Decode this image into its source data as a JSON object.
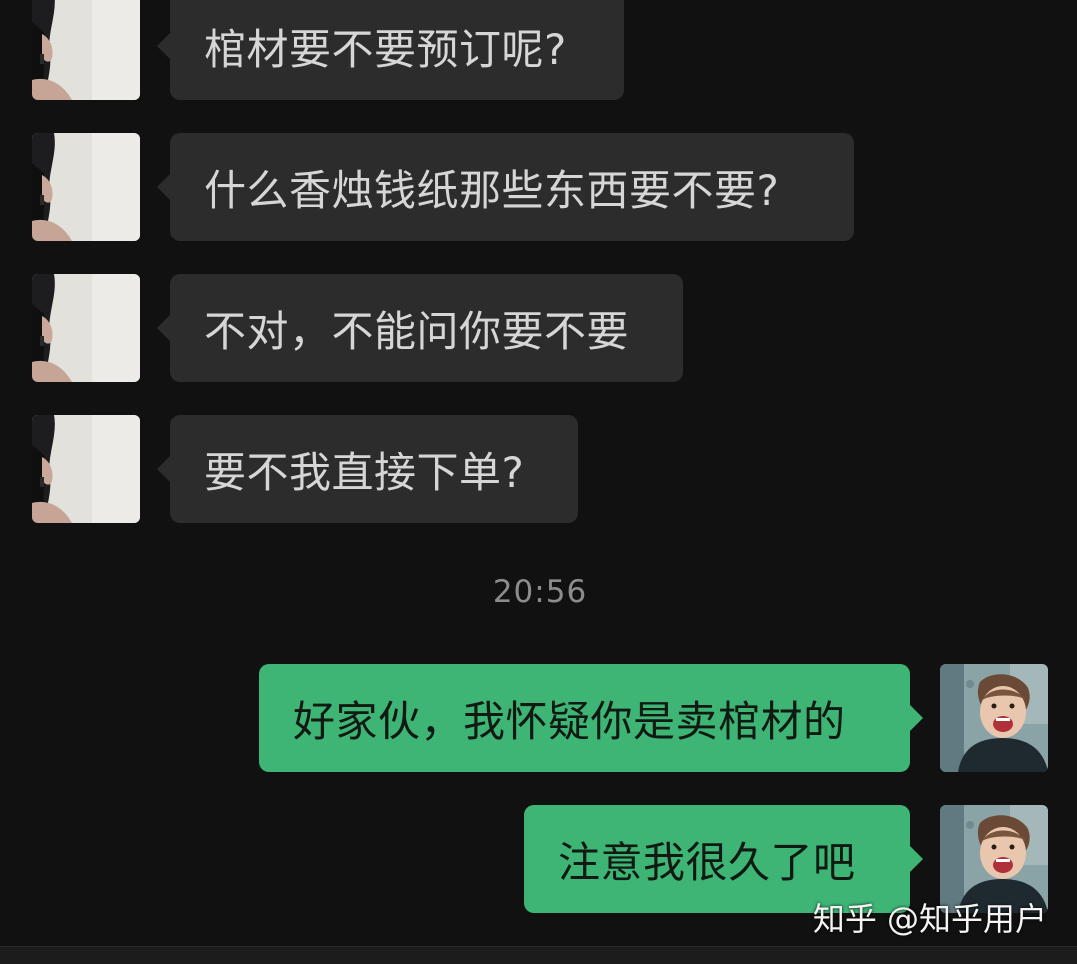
{
  "messages": [
    {
      "text": "棺材要不要预订呢?"
    },
    {
      "text": "什么香烛钱纸那些东西要不要?"
    },
    {
      "text": "不对，不能问你要不要"
    },
    {
      "text": "要不我直接下单?"
    },
    {
      "text": "好家伙，我怀疑你是卖棺材的"
    },
    {
      "text": "注意我很久了吧"
    }
  ],
  "timestamp": "20:56",
  "watermark": "知乎 @知乎用户",
  "colors": {
    "background": "#111111",
    "incoming_bubble": "#2c2c2c",
    "outgoing_bubble": "#3eb575"
  }
}
